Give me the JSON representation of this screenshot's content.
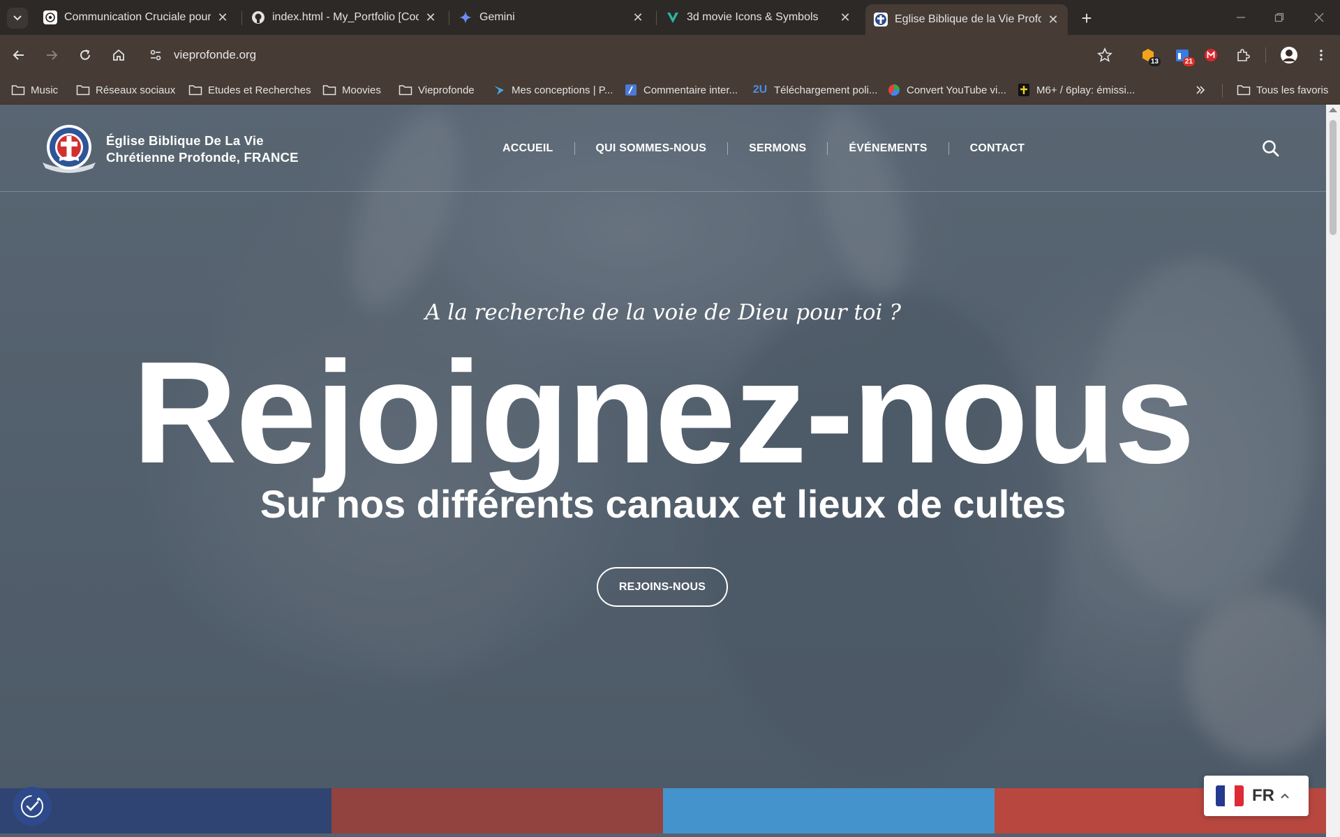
{
  "browser": {
    "tabs": [
      {
        "title": "Communication Cruciale pour D",
        "favicon": "openai-icon",
        "active": false
      },
      {
        "title": "index.html - My_Portfolio [Code",
        "favicon": "github-icon",
        "active": false
      },
      {
        "title": "Gemini",
        "favicon": "gemini-icon",
        "active": false
      },
      {
        "title": "3d movie Icons & Symbols",
        "favicon": "vecteezy-icon",
        "active": false
      },
      {
        "title": "Eglise Biblique de la Vie Profonde",
        "favicon": "church-icon",
        "active": true
      }
    ],
    "address": "vieprofonde.org",
    "extensions": [
      {
        "name": "extension-honey",
        "badge": "13",
        "color": "#f2a31b"
      },
      {
        "name": "extension-calendar",
        "badge": "21",
        "color": "#3b7ae0"
      },
      {
        "name": "extension-mega",
        "badge": "",
        "color": "#d9272e"
      }
    ],
    "bookmarks": [
      {
        "label": "Music",
        "icon": "folder-icon"
      },
      {
        "label": "Réseaux sociaux",
        "icon": "folder-icon"
      },
      {
        "label": "Etudes et Recherches",
        "icon": "folder-icon"
      },
      {
        "label": "Moovies",
        "icon": "folder-icon"
      },
      {
        "label": "Vieprofonde",
        "icon": "folder-icon"
      },
      {
        "label": "Mes conceptions | P...",
        "icon": "behance-icon"
      },
      {
        "label": "Commentaire inter...",
        "icon": "translate-icon"
      },
      {
        "label": "Téléchargement poli...",
        "icon": "2u-icon"
      },
      {
        "label": "Convert YouTube vi...",
        "icon": "converter-icon"
      },
      {
        "label": "M6+ / 6play: émissi...",
        "icon": "m6-icon"
      }
    ],
    "all_bookmarks": "Tous les favoris"
  },
  "site": {
    "logo_line1": "Église Biblique De La Vie",
    "logo_line2": "Chrétienne Profonde, FRANCE",
    "nav": [
      "ACCUEIL",
      "QUI SOMMES-NOUS",
      "SERMONS",
      "ÉVÉNEMENTS",
      "CONTACT"
    ],
    "hero": {
      "tagline": "A la recherche de la voie de Dieu pour toi ?",
      "headline": "Rejoignez-nous",
      "subhead": "Sur nos différents canaux et lieux de cultes",
      "cta": "REJOINS-NOUS"
    },
    "strip_colors": [
      "#2f4472",
      "#93433f",
      "#4493cc",
      "#b8473f"
    ],
    "language": {
      "code": "FR",
      "flag_colors": [
        "#25398e",
        "#ffffff",
        "#dd2a35"
      ]
    }
  }
}
